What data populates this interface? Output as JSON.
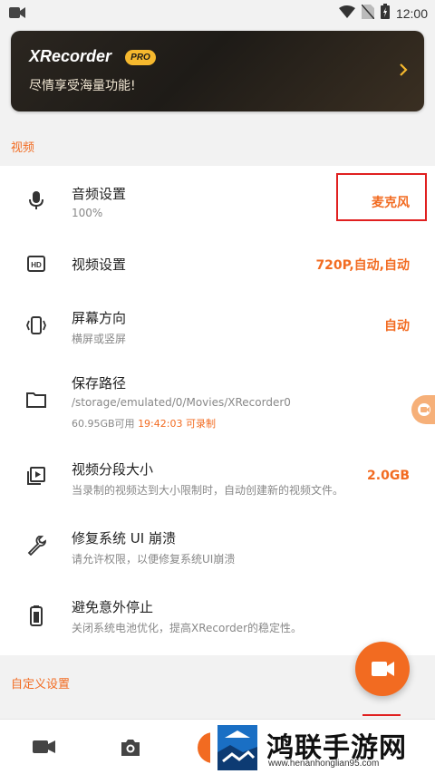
{
  "status_bar": {
    "time": "12:00"
  },
  "banner": {
    "title": "XRecorder",
    "badge": "PRO",
    "subtitle": "尽情享受海量功能!"
  },
  "sections": {
    "video": "视频",
    "custom": "自定义设置"
  },
  "rows": {
    "audio": {
      "title": "音频设置",
      "sub": "100%",
      "value": "麦克风"
    },
    "video_settings": {
      "title": "视频设置",
      "value": "720P,自动,自动"
    },
    "orientation": {
      "title": "屏幕方向",
      "sub": "横屏或竖屏",
      "value": "自动"
    },
    "save_path": {
      "title": "保存路径",
      "sub": "/storage/emulated/0/Movies/XRecorder0",
      "storage": "60.95GB可用",
      "duration": "19:42:03 可录制"
    },
    "segment": {
      "title": "视频分段大小",
      "sub": "当录制的视频达到大小限制时，自动创建新的视频文件。",
      "value": "2.0GB"
    },
    "fix_ui": {
      "title": "修复系统 UI 崩溃",
      "sub": "请允许权限，以便修复系统UI崩溃"
    },
    "prevent_stop": {
      "title": "避免意外停止",
      "sub": "关闭系统电池优化，提高XRecorder的稳定性。"
    }
  },
  "watermark": {
    "text": "鸿联手游网",
    "url": "www.henanhonglian95.com"
  },
  "colors": {
    "accent": "#f26b21",
    "highlight_box": "#e02020",
    "banner_gold": "#f5b82e"
  }
}
